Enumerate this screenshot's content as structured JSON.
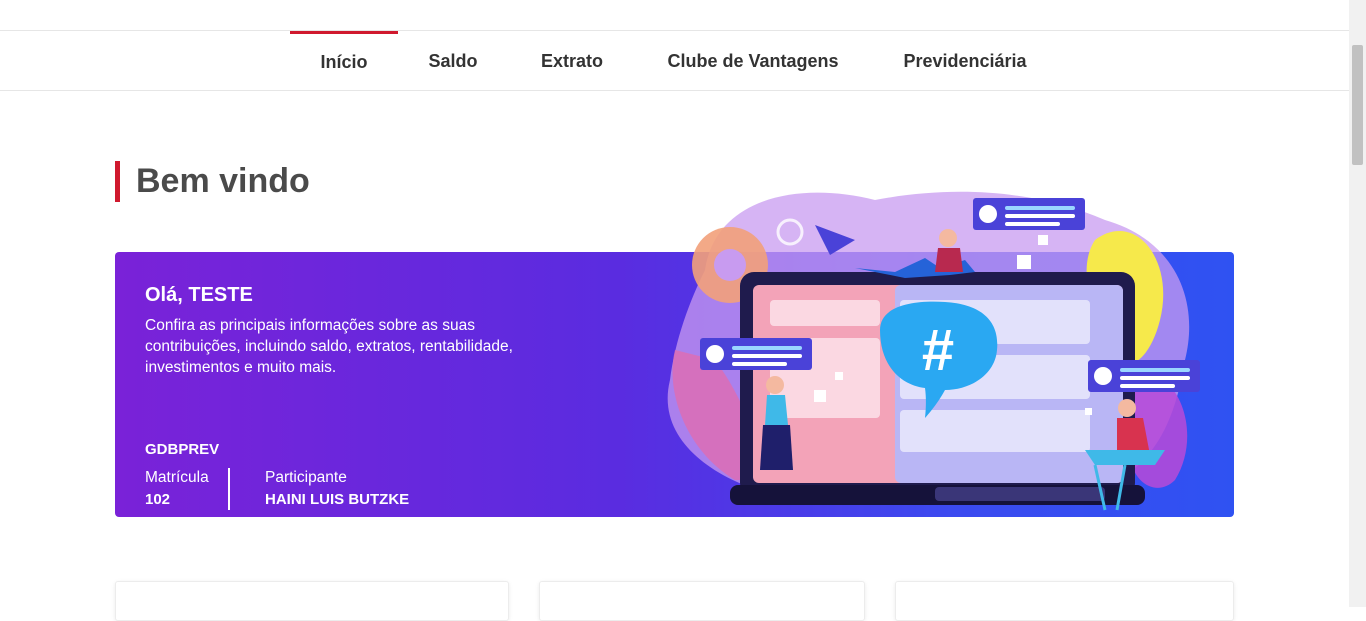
{
  "nav": {
    "items": [
      {
        "label": "Início",
        "active": true
      },
      {
        "label": "Saldo",
        "active": false
      },
      {
        "label": "Extrato",
        "active": false
      },
      {
        "label": "Clube de Vantagens",
        "active": false
      },
      {
        "label": "Previdenciária",
        "active": false
      }
    ]
  },
  "page": {
    "title": "Bem vindo"
  },
  "banner": {
    "greeting": "Olá, TESTE",
    "intro": "Confira as principais informações sobre as suas contribuições, incluindo saldo, extratos, rentabilidade, investimentos e muito mais.",
    "organization": "GDBPREV",
    "matricula_label": "Matrícula",
    "matricula_value": "102",
    "participante_label": "Participante",
    "participante_value": "HAINI LUIS BUTZKE",
    "illustration_hashtag": "#"
  },
  "colors": {
    "accent": "#d0192e",
    "banner_start": "#7a22d8",
    "banner_end": "#2f52f2"
  }
}
